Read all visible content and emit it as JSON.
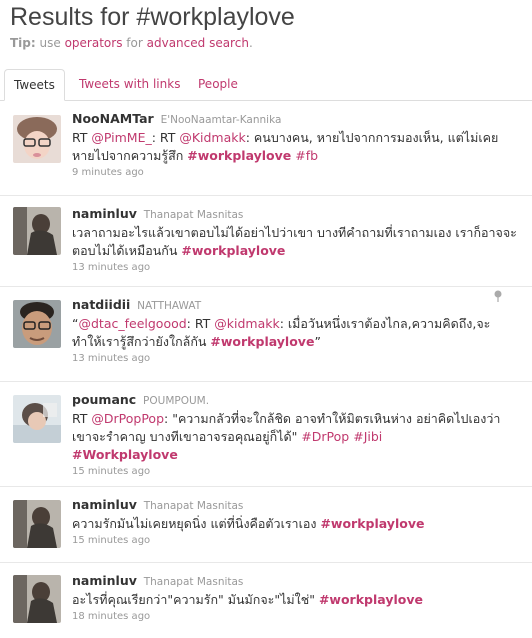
{
  "header": {
    "title": "Results for #workplaylove",
    "tip_label": "Tip:",
    "tip_pre": "use",
    "tip_link1": "operators",
    "tip_mid": "for",
    "tip_link2": "advanced search",
    "tip_end": "."
  },
  "tabs": [
    {
      "label": "Tweets"
    },
    {
      "label": "Tweets with links"
    },
    {
      "label": "People"
    }
  ],
  "tweets": [
    {
      "username": "NooNAMTar",
      "fullname": "E'NooNaamtar-Kannika",
      "t1": "RT ",
      "t2": "@PimME_",
      "t3": ": RT ",
      "t4": "@Kidmakk",
      "t5": ": คนบางคน, หายไปจากการมองเห็น, แต่ไม่เคยหายไปจากความรู้สึก ",
      "t6": "#workplaylove",
      "t7": " ",
      "t8": "#fb",
      "time": "9 minutes ago"
    },
    {
      "username": "naminluv",
      "fullname": "Thanapat Masnitas",
      "t1": "เวลาถามอะไรแล้วเขาตอบไม่ได้อย่าไปว่าเขา บางทีคำถามที่เราถามเอง เราก็อาจจะตอบไม่ได้เหมือนกัน ",
      "t2": "#workplaylove",
      "time": "13 minutes ago"
    },
    {
      "username": "natdiidii",
      "fullname": "NATTHAWAT",
      "t1": "“",
      "t2": "@dtac_feelgoood",
      "t3": ": RT ",
      "t4": "@kidmakk",
      "t5": ": เมื่อวันหนึ่งเราต้องไกล,ความคิดถึง,จะทำให้เรารู้สึกว่ายังใกล้กัน ",
      "t6": "#workplaylove",
      "t7": "”",
      "time": "13 minutes ago"
    },
    {
      "username": "poumanc",
      "fullname": "POUMPOUM.",
      "t1": "RT ",
      "t2": "@DrPopPop",
      "t3": ": \"ความกลัวที่จะใกล้ชิด อาจทำให้มิตรเหินห่าง อย่าคิดไปเองว่าเขาจะรำคาญ บางทีเขาอาจรอคุณอยู่ก็ได้\" ",
      "t4": "#DrPop",
      "t5": " ",
      "t6": "#Jibi",
      "t7": "#Workplaylove",
      "time": "15 minutes ago"
    },
    {
      "username": "naminluv",
      "fullname": "Thanapat Masnitas",
      "t1": "ความรักมันไม่เคยหยุดนิ่ง แต่ที่นิ่งคือตัวเราเอง ",
      "t2": "#workplaylove",
      "time": "15 minutes ago"
    },
    {
      "username": "naminluv",
      "fullname": "Thanapat Masnitas",
      "t1": "อะไรที่คุณเรียกว่า\"ความรัก\" มันมักจะ\"ไม่ใช่\" ",
      "t2": "#workplaylove",
      "time": "18 minutes ago"
    }
  ],
  "colors": {
    "link": "#c0396e",
    "muted": "#999999",
    "text": "#333333"
  }
}
